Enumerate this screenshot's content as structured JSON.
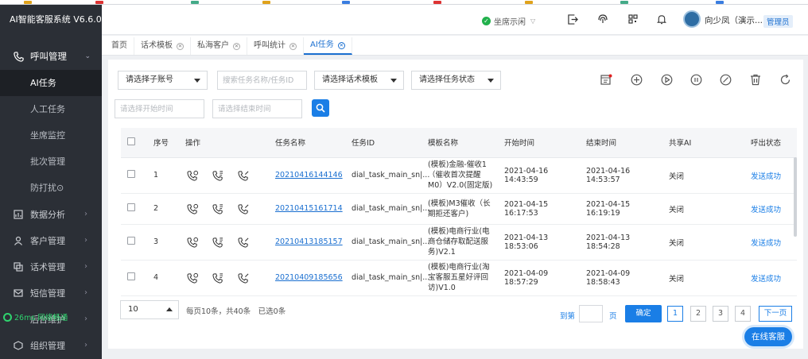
{
  "app": {
    "title": "AI智能客服系统 V6.6.0"
  },
  "colors": {
    "sidebar_bg": "#2b2f36",
    "accent": "#1a7ee6",
    "status_ok": "#22b14c",
    "net_ok": "#2fd36e"
  },
  "sidebar": {
    "group": {
      "label": "呼叫管理",
      "icon": "phone-icon"
    },
    "sub_items": [
      {
        "label": "AI任务",
        "active": true
      },
      {
        "label": "人工任务"
      },
      {
        "label": "坐席监控"
      },
      {
        "label": "批次管理"
      },
      {
        "label": "防打扰⊙"
      }
    ],
    "main_items": [
      {
        "label": "数据分析",
        "icon": "chart-icon"
      },
      {
        "label": "客户管理",
        "icon": "user-icon"
      },
      {
        "label": "话术管理",
        "icon": "script-icon"
      },
      {
        "label": "短信管理",
        "icon": "mail-icon"
      },
      {
        "label": "后台维护",
        "icon": "settings-icon"
      },
      {
        "label": "组织管理",
        "icon": "org-icon"
      }
    ],
    "network": "26ms 网络畅通"
  },
  "header": {
    "seat_status": "坐席示闲",
    "username": "向少凤（演示...",
    "role": "管理员"
  },
  "tabs": [
    {
      "label": "首页",
      "closable": false
    },
    {
      "label": "话术模板",
      "closable": true
    },
    {
      "label": "私海客户",
      "closable": true
    },
    {
      "label": "呼叫统计",
      "closable": true
    },
    {
      "label": "AI任务",
      "closable": true,
      "active": true
    }
  ],
  "filters": {
    "sub_account": "请选择子账号",
    "task_search_placeholder": "搜索任务名称/任务ID",
    "template": "请选择话术模板",
    "task_status": "请选择任务状态",
    "start_time_placeholder": "请选择开始时间",
    "end_time_placeholder": "请选择结束时间"
  },
  "table": {
    "columns": [
      "序号",
      "操作",
      "任务名称",
      "任务ID",
      "模板名称",
      "开始时间",
      "结束时间",
      "共享AI",
      "呼出状态"
    ],
    "rows": [
      {
        "index": "1",
        "name": "20210416144146",
        "id": "dial_task_main_sn|...",
        "template": "(模板)金融-催收1（催收首次提醒M0）V2.0(固定版)",
        "start": "2021-04-16 14:43:59",
        "end": "2021-04-16 14:53:57",
        "shared_ai": "关闭",
        "status": "发送成功"
      },
      {
        "index": "2",
        "name": "20210415161714",
        "id": "dial_task_main_sn|...",
        "template": "(模板)M3催收（长期拒还客户)",
        "start": "2021-04-15 16:17:53",
        "end": "2021-04-15 16:19:19",
        "shared_ai": "关闭",
        "status": "发送成功"
      },
      {
        "index": "3",
        "name": "20210413185157",
        "id": "dial_task_main_sn|...",
        "template": "(模板)电商行业(电商仓储存取配送服务)V2.1",
        "start": "2021-04-13 18:53:06",
        "end": "2021-04-13 18:54:28",
        "shared_ai": "关闭",
        "status": "发送成功"
      },
      {
        "index": "4",
        "name": "20210409185656",
        "id": "dial_task_main_sn|...",
        "template": "(模板)电商行业(淘宝客服五星好评回访)V1.0",
        "start": "2021-04-09 18:57:29",
        "end": "2021-04-09 18:58:43",
        "shared_ai": "关闭",
        "status": "发送成功"
      }
    ]
  },
  "pagination": {
    "page_size": "10",
    "info": "每页10条，共40条　已选0条",
    "goto_label": "到第",
    "page_label": "页",
    "confirm": "确定",
    "pages": [
      "1",
      "2",
      "3",
      "4"
    ],
    "current_page": "1",
    "next": "下一页"
  },
  "online_cs": "在线客服"
}
